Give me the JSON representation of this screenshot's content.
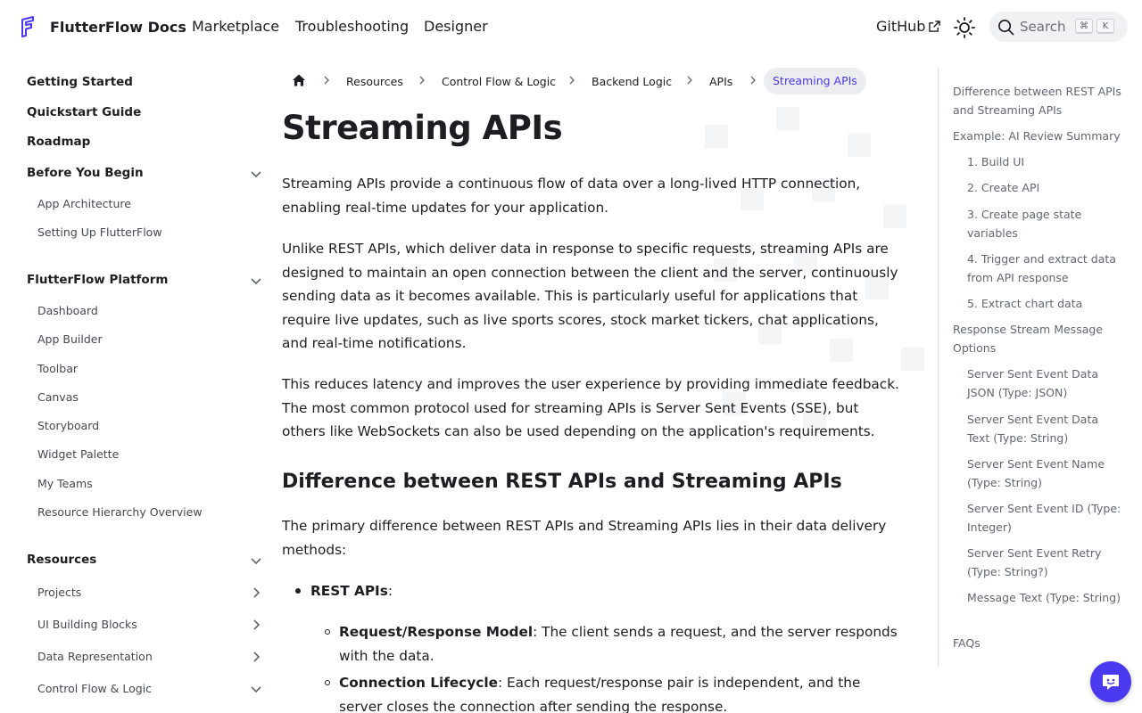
{
  "navbar": {
    "brand": "FlutterFlow Docs",
    "links": [
      "Marketplace",
      "Troubleshooting",
      "Designer"
    ],
    "github": "GitHub",
    "search_placeholder": "Search",
    "kbd_cmd": "⌘",
    "kbd_k": "K"
  },
  "sidebar": {
    "getting_started": "Getting Started",
    "quickstart": "Quickstart Guide",
    "roadmap": "Roadmap",
    "before_you_begin": "Before You Begin",
    "before_items": [
      "App Architecture",
      "Setting Up FlutterFlow"
    ],
    "platform": "FlutterFlow Platform",
    "platform_items": [
      "Dashboard",
      "App Builder",
      "Toolbar",
      "Canvas",
      "Storyboard",
      "Widget Palette",
      "My Teams",
      "Resource Hierarchy Overview"
    ],
    "resources": "Resources",
    "resource_items": [
      "Projects",
      "UI Building Blocks",
      "Data Representation",
      "Control Flow & Logic"
    ]
  },
  "breadcrumbs": {
    "items": [
      "Resources",
      "Control Flow & Logic",
      "Backend Logic",
      "APIs"
    ],
    "active": "Streaming APIs"
  },
  "article": {
    "title": "Streaming APIs",
    "p1": "Streaming APIs provide a continuous flow of data over a long-lived HTTP connection, enabling real-time updates for your application.",
    "p2": "Unlike REST APIs, which deliver data in response to specific requests, streaming APIs are designed to maintain an open connection between the client and the server, continuously sending data as it becomes available. This is particularly useful for applications that require live updates, such as live sports scores, stock market tickers, chat applications, and real-time notifications.",
    "p3": "This reduces latency and improves the user experience by providing immediate feedback. The most common protocol used for streaming APIs is Server Sent Events (SSE), but others like WebSockets can also be used depending on the application's requirements.",
    "h2": "Difference between REST APIs and Streaming APIs",
    "p4": "The primary difference between REST APIs and Streaming APIs lies in their data delivery methods:",
    "b1_bold": "REST APIs",
    "b1_rest": ":",
    "b2_bold": "Request/Response Model",
    "b2_rest": ": The client sends a request, and the server responds with the data.",
    "b3_bold": "Connection Lifecycle",
    "b3_rest": ": Each request/response pair is independent, and the server closes the connection after sending the response."
  },
  "toc": {
    "items": [
      "Difference between REST APIs and Streaming APIs",
      "Example: AI Review Summary",
      "1. Build UI",
      "2. Create API",
      "3. Create page state variables",
      "4. Trigger and extract data from API response",
      "5. Extract chart data",
      "Response Stream Message Options",
      "Server Sent Event Data JSON (Type: JSON)",
      "Server Sent Event Data Text (Type: String)",
      "Server Sent Event Name (Type: String)",
      "Server Sent Event ID (Type: Integer)",
      "Server Sent Event Retry (Type: String?)",
      "Message Text (Type: String)",
      "FAQs"
    ]
  },
  "colors": {
    "accent": "#4b39ef",
    "text": "#1c1e21",
    "muted": "#606770"
  }
}
